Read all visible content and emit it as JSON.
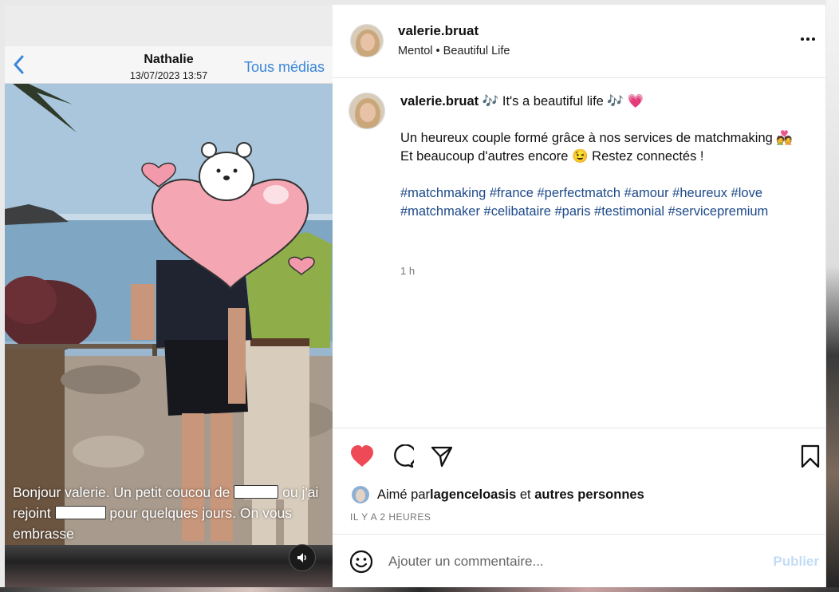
{
  "media": {
    "contact_name": "Nathalie",
    "contact_date": "13/07/2023 13:57",
    "all_media_label": "Tous médias",
    "caption_part1": "Bonjour valerie. Un petit coucou de",
    "caption_part2": "ou j'ai rejoint",
    "caption_part3": "pour quelques jours. On vous embrasse"
  },
  "post": {
    "username": "valerie.bruat",
    "music": "Mentol • Beautiful Life",
    "comment_username": "valerie.bruat",
    "comment_line1": " 🎶 It's a beautiful life 🎶 💗",
    "comment_body": "Un heureux couple formé grâce à nos services de matchmaking 💑 Et beaucoup d'autres encore 😉 Restez connectés !",
    "hashtags": "#matchmaking #france #perfectmatch #amour #heureux #love #matchmaker #celibataire #paris #testimonial #servicepremium",
    "age": "1 h",
    "liked_prefix": "Aimé par ",
    "liked_user": "lagenceloasis",
    "liked_and": " et ",
    "liked_others": "autres personnes",
    "time_ago": "IL Y A 2 HEURES",
    "comment_placeholder": "Ajouter un commentaire...",
    "publish_label": "Publier"
  },
  "colors": {
    "like": "#ed4956",
    "link": "#1d4a8a",
    "ios_blue": "#3a86d9",
    "publish_disabled": "#c2dcf6"
  },
  "icons": [
    "back-chevron-icon",
    "more-options-icon",
    "heart-icon",
    "comment-icon",
    "share-icon",
    "bookmark-icon",
    "emoji-icon",
    "speaker-icon"
  ]
}
